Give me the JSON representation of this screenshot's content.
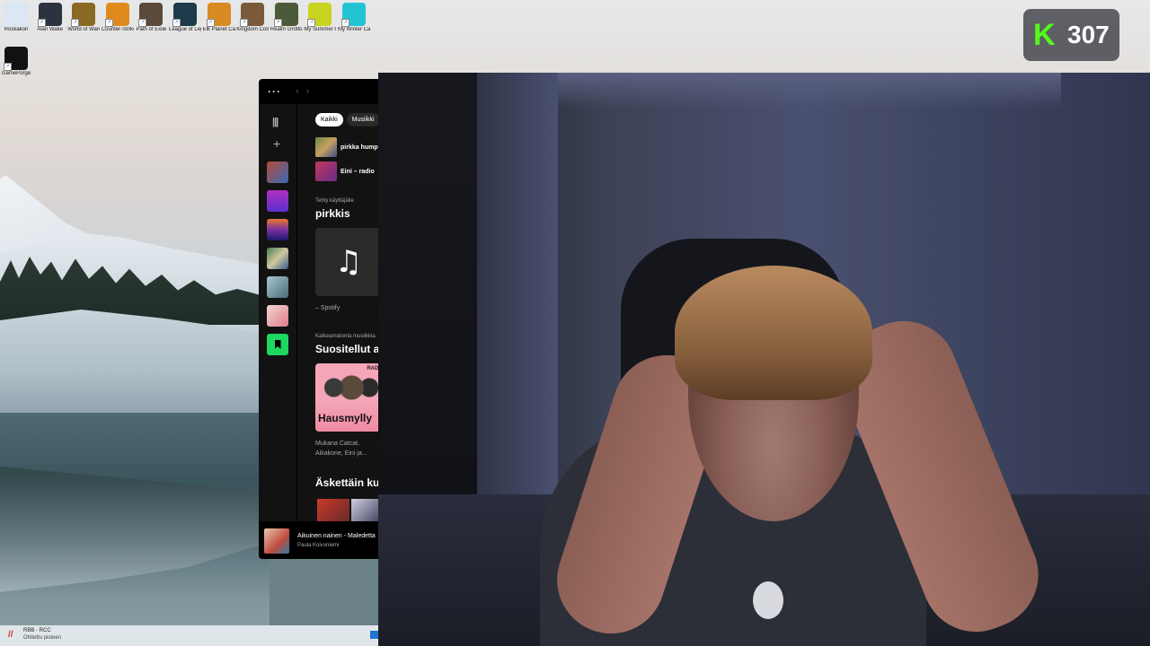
{
  "desktop": {
    "icons": [
      {
        "label": "Roskakori",
        "icon": "recycle-bin-icon",
        "color": "#dbe7f2"
      },
      {
        "label": "Alan Wake",
        "icon": "alan-wake-icon",
        "color": "#2c3340"
      },
      {
        "label": "World of Warcraft",
        "icon": "wow-icon",
        "color": "#8a6a22"
      },
      {
        "label": "Counter-Strike 2",
        "icon": "cs2-icon",
        "color": "#e08a1e"
      },
      {
        "label": "Path of Exile",
        "icon": "poe-icon",
        "color": "#5a4a3a"
      },
      {
        "label": "League of Legends",
        "icon": "lol-icon",
        "color": "#1d3b4a"
      },
      {
        "label": "Elk Planet Call of the...",
        "icon": "game-icon",
        "color": "#d98a22"
      },
      {
        "label": "Kingdom Come Deliverance",
        "icon": "kcd-icon",
        "color": "#7a5a3a"
      },
      {
        "label": "Realm Grotto...",
        "icon": "game-icon",
        "color": "#4a5a3a"
      },
      {
        "label": "My Summer Car",
        "icon": "msc-icon",
        "color": "#c8d41e"
      },
      {
        "label": "My Winter Car",
        "icon": "mwc-icon",
        "color": "#22c4d4"
      },
      {
        "label": "GamePorge",
        "icon": "anvil-icon",
        "color": "#111111"
      }
    ]
  },
  "spotify": {
    "chips": [
      "Kaikki",
      "Musiikki"
    ],
    "recent": [
      {
        "title": "pirkka humpp"
      },
      {
        "title": "Eini – radio"
      }
    ],
    "made_for_small": "Tehty käyttäjälle",
    "made_for_title": "pirkkis",
    "made_for_caption": "– Spotify",
    "section2_small": "Katkeamatonta musiikkia",
    "section2_title": "Suositellut as",
    "card_tag": "RADI",
    "card_title": "Hausmylly",
    "card_sub1": "Mukana Catcat,",
    "card_sub2": "Aikakone, Eini ja...",
    "section3_title": "Äskettäin ku",
    "now_playing": {
      "song": "Aikuinen nainen - Maledetta",
      "artist": "Paula Koivuniemi"
    },
    "accent": "#1ed760"
  },
  "badge": {
    "letter": "K",
    "count": "307",
    "accent": "#53fc18"
  },
  "taskbar": {
    "app_title": "RBB - RCC",
    "app_sub": "Ohitettu pisteen"
  }
}
